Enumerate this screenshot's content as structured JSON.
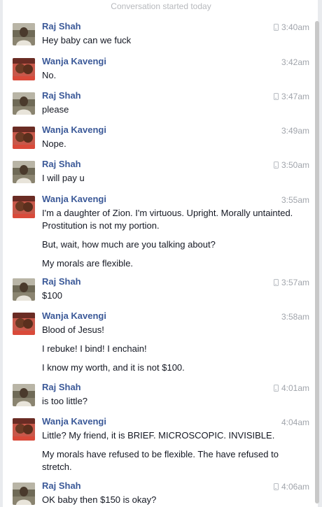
{
  "header": {
    "started": "Conversation started today"
  },
  "colors": {
    "name": "#3b5998",
    "text": "#141823",
    "time": "#a0a4ab"
  },
  "messages": [
    {
      "sender": "Raj Shah",
      "time": "3:40am",
      "via_mobile": true,
      "avatar_icon": "raj-avatar",
      "lines": [
        "Hey baby can we fuck"
      ]
    },
    {
      "sender": "Wanja Kavengi",
      "time": "3:42am",
      "via_mobile": false,
      "avatar_icon": "wanja-avatar",
      "lines": [
        "No."
      ]
    },
    {
      "sender": "Raj Shah",
      "time": "3:47am",
      "via_mobile": true,
      "avatar_icon": "raj-avatar",
      "lines": [
        "please"
      ]
    },
    {
      "sender": "Wanja Kavengi",
      "time": "3:49am",
      "via_mobile": false,
      "avatar_icon": "wanja-avatar",
      "lines": [
        "Nope."
      ]
    },
    {
      "sender": "Raj Shah",
      "time": "3:50am",
      "via_mobile": true,
      "avatar_icon": "raj-avatar",
      "lines": [
        "I will pay u"
      ]
    },
    {
      "sender": "Wanja Kavengi",
      "time": "3:55am",
      "via_mobile": false,
      "avatar_icon": "wanja-avatar",
      "lines": [
        "I'm a daughter of Zion. I'm virtuous. Upright. Morally untainted. Prostitution is not my portion.",
        "But, wait, how much are you talking about?",
        "My morals are flexible."
      ]
    },
    {
      "sender": "Raj Shah",
      "time": "3:57am",
      "via_mobile": true,
      "avatar_icon": "raj-avatar",
      "lines": [
        "$100"
      ]
    },
    {
      "sender": "Wanja Kavengi",
      "time": "3:58am",
      "via_mobile": false,
      "avatar_icon": "wanja-avatar",
      "lines": [
        "Blood of Jesus!",
        "I rebuke! I bind! I enchain!",
        "I know my worth, and it is not $100."
      ]
    },
    {
      "sender": "Raj Shah",
      "time": "4:01am",
      "via_mobile": true,
      "avatar_icon": "raj-avatar",
      "lines": [
        "is too little?"
      ]
    },
    {
      "sender": "Wanja Kavengi",
      "time": "4:04am",
      "via_mobile": false,
      "avatar_icon": "wanja-avatar",
      "lines": [
        "Little? My friend, it is BRIEF. MICROSCOPIC. INVISIBLE.",
        "My morals have refused to be flexible. The have refused to stretch."
      ]
    },
    {
      "sender": "Raj Shah",
      "time": "4:06am",
      "via_mobile": true,
      "avatar_icon": "raj-avatar",
      "lines": [
        "OK baby then $150 is okay?"
      ]
    }
  ]
}
